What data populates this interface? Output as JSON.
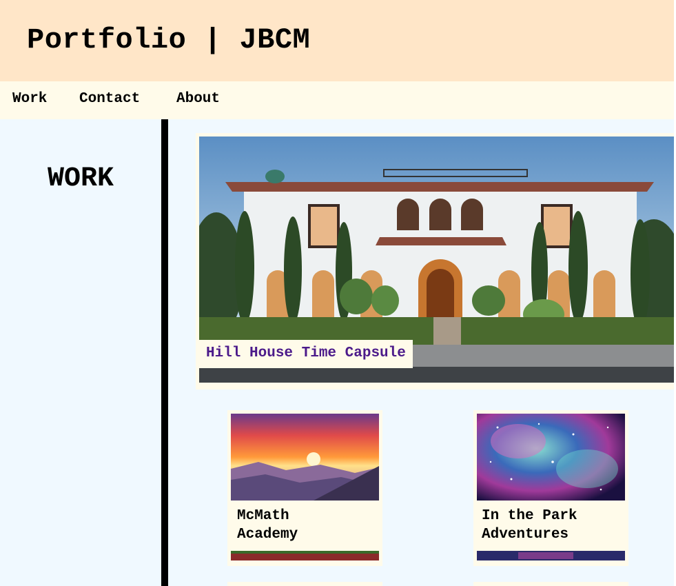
{
  "header": {
    "title": "Portfolio | JBCM"
  },
  "nav": {
    "items": [
      "Work",
      "Contact",
      "About"
    ]
  },
  "sidebar": {
    "title": "WORK"
  },
  "featured": {
    "title": "Hill House Time Capsule"
  },
  "cards": [
    {
      "title_line1": "McMath",
      "title_line2": "Academy"
    },
    {
      "title_line1": "In the Park",
      "title_line2": "Adventures"
    }
  ],
  "colors": {
    "header_bg": "#ffe6c8",
    "nav_bg": "#fffbea",
    "page_bg": "#f0f9ff",
    "featured_label": "#4b1a8a"
  }
}
